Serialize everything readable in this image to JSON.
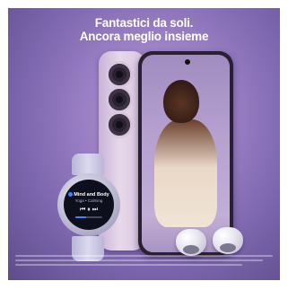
{
  "headline": {
    "line1": "Fantastici da soli.",
    "line2": "Ancora meglio insieme"
  },
  "watch": {
    "app_name": "Mind and Body",
    "track": "Yoga • Calming",
    "controls": "⏮ ⏸ ⏭",
    "playback_progress": 0.4
  },
  "colors": {
    "background": "#8f75bd",
    "phone_lavender": "#dcc8e2",
    "text": "#ffffff"
  },
  "icons": [
    "camera-lens-icon",
    "earbud-icon",
    "play-pause-icon"
  ]
}
